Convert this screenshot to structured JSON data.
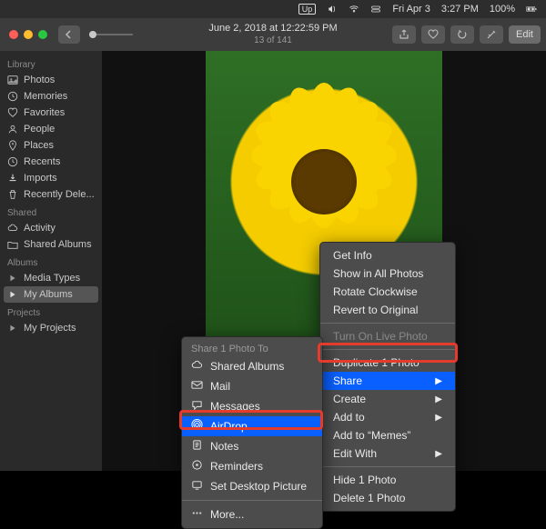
{
  "menubar": {
    "up": "Up",
    "day": "Fri Apr 3",
    "time": "3:27 PM",
    "battery": "100%"
  },
  "titlebar": {
    "title": "June 2, 2018 at 12:22:59 PM",
    "subtitle": "13 of 141",
    "edit": "Edit"
  },
  "sidebar": {
    "h1": "Library",
    "library": [
      "Photos",
      "Memories",
      "Favorites",
      "People",
      "Places",
      "Recents",
      "Imports",
      "Recently Dele..."
    ],
    "h2": "Shared",
    "shared": [
      "Activity",
      "Shared Albums"
    ],
    "h3": "Albums",
    "albums": [
      "Media Types",
      "My Albums"
    ],
    "h4": "Projects",
    "projects": [
      "My Projects"
    ]
  },
  "context1": {
    "items": [
      {
        "t": "Get Info"
      },
      {
        "t": "Show in All Photos"
      },
      {
        "t": "Rotate Clockwise"
      },
      {
        "t": "Revert to Original"
      },
      {
        "sep": true
      },
      {
        "t": "Turn On Live Photo",
        "disabled": true
      },
      {
        "sep": true
      },
      {
        "t": "Duplicate 1 Photo"
      },
      {
        "t": "Share",
        "sub": true,
        "hl": true
      },
      {
        "t": "Create",
        "sub": true
      },
      {
        "t": "Add to",
        "sub": true
      },
      {
        "t": "Add to “Memes”"
      },
      {
        "t": "Edit With",
        "sub": true
      },
      {
        "sep": true
      },
      {
        "t": "Hide 1 Photo"
      },
      {
        "t": "Delete 1 Photo"
      }
    ]
  },
  "context2": {
    "title": "Share 1 Photo To",
    "items": [
      {
        "t": "Shared Albums",
        "icon": "cloud"
      },
      {
        "t": "Mail",
        "icon": "mail"
      },
      {
        "t": "Messages",
        "icon": "msg"
      },
      {
        "t": "AirDrop",
        "icon": "airdrop",
        "hl": true
      },
      {
        "t": "Notes",
        "icon": "notes"
      },
      {
        "t": "Reminders",
        "icon": "rem"
      },
      {
        "t": "Set Desktop Picture",
        "icon": "desk"
      },
      {
        "sep": true
      },
      {
        "t": "More...",
        "icon": "more"
      }
    ]
  }
}
